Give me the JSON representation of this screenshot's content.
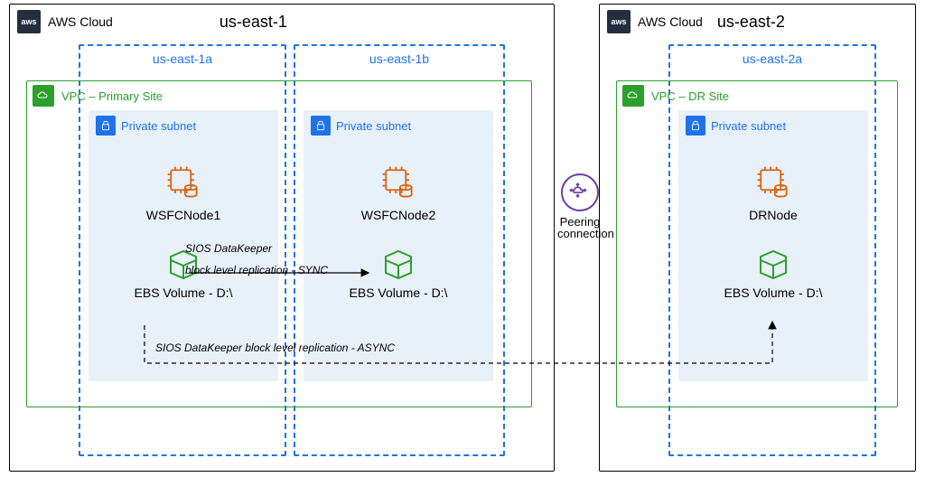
{
  "region1": {
    "cloud_label": "AWS Cloud",
    "region": "us-east-1",
    "az1": {
      "label": "us-east-1a"
    },
    "az2": {
      "label": "us-east-1b"
    },
    "vpc": {
      "label": "VPC – Primary Site"
    },
    "subnet1": {
      "label": "Private subnet",
      "node": "WSFCNode1",
      "volume": "EBS Volume - D:\\"
    },
    "subnet2": {
      "label": "Private subnet",
      "node": "WSFCNode2",
      "volume": "EBS Volume - D:\\"
    },
    "sync_line1": "SIOS DataKeeper",
    "sync_line2": "block level  replication - SYNC",
    "async_label": "SIOS DataKeeper block level  replication - ASYNC"
  },
  "region2": {
    "cloud_label": "AWS Cloud",
    "region": "us-east-2",
    "az": {
      "label": "us-east-2a"
    },
    "vpc": {
      "label": "VPC – DR Site"
    },
    "subnet": {
      "label": "Private subnet",
      "node": "DRNode",
      "volume": "EBS Volume - D:\\"
    }
  },
  "peering": {
    "label_line1": "Peering",
    "label_line2": "connection"
  }
}
